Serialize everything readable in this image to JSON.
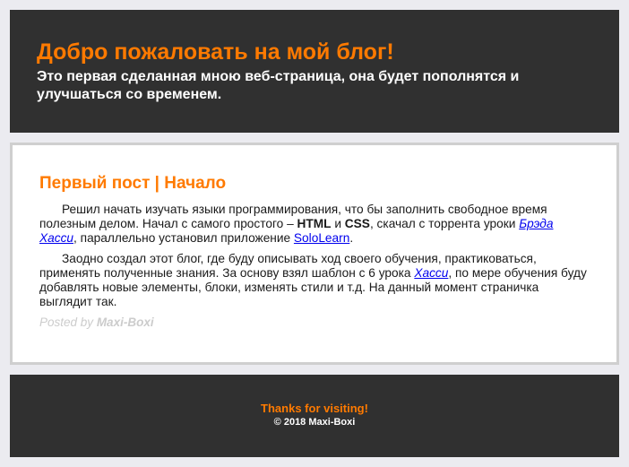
{
  "header": {
    "title": "Добро пожаловать на мой блог!",
    "subtitle": "Это первая сделанная мною веб-страница, она будет пополнятся и улучшаться со временем."
  },
  "post": {
    "title": "Первый пост | Начало",
    "p1": {
      "t1": "Решил начать изучать языки программирования, что бы заполнить свободное время полезным делом. Начал с самого простого – ",
      "html": "HTML",
      "t2": " и ",
      "css": "CSS",
      "t3": ", скачал с торрента уроки ",
      "link1": "Брэда Хасси",
      "t4": ", параллельно установил приложение ",
      "link2": "SoloLearn",
      "t5": "."
    },
    "p2": {
      "t1": "Заодно создал этот блог, где буду описывать ход своего обучения, практиковаться, применять полученные знания. За основу взял шаблон с 6 урока ",
      "link": "Хасси",
      "t2": ", по мере обучения буду добавлять новые элементы, блоки, изменять стили и т.д. На данный момент страничка выглядит так."
    },
    "posted_by_label": "Posted by",
    "author": "Maxi-Boxi"
  },
  "footer": {
    "thanks": "Thanks for visiting!",
    "copyright": "© 2018 Maxi-Boxi"
  },
  "colors": {
    "accent": "#ff7a00",
    "dark_panel": "#303030",
    "page_bg": "#ebebf0",
    "link": "#0000ee"
  }
}
